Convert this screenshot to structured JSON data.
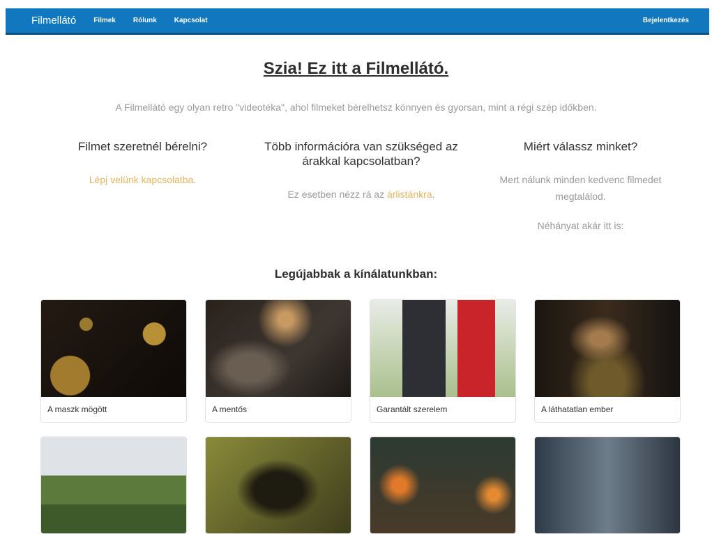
{
  "nav": {
    "brand": "Filmellátó",
    "links": [
      "Filmek",
      "Rólunk",
      "Kapcsolat"
    ],
    "login": "Bejelentkezés"
  },
  "hero": {
    "title": "Szia! Ez itt a Filmellátó.",
    "subtitle": "A Filmellátó egy olyan retro \"videotéka\", ahol filmeket bérelhetsz könnyen és gyorsan, mint a régi szép időkben."
  },
  "columns": [
    {
      "heading": "Filmet szeretnél bérelni?",
      "link": "Lépj velünk kapcsolatba",
      "after": "."
    },
    {
      "heading": "Több információra van szükséged az árakkal kapcsolatban?",
      "before": "Ez esetben nézz rá az ",
      "link": "árlistánkra",
      "after": "."
    },
    {
      "heading": "Miért válassz minket?",
      "text1": "Mert nálunk minden kedvenc filmedet megtalálod.",
      "text2": "Néhányat akár itt is:"
    }
  ],
  "latest": {
    "title": "Legújabbak a kínálatunkban:",
    "movies": [
      "A maszk mögött",
      "A mentős",
      "Garantált szerelem",
      "A láthatatlan ember"
    ]
  },
  "colors": {
    "navbar": "#1177be",
    "accent_link": "#e5b662",
    "muted_text": "#9a9a9a"
  }
}
